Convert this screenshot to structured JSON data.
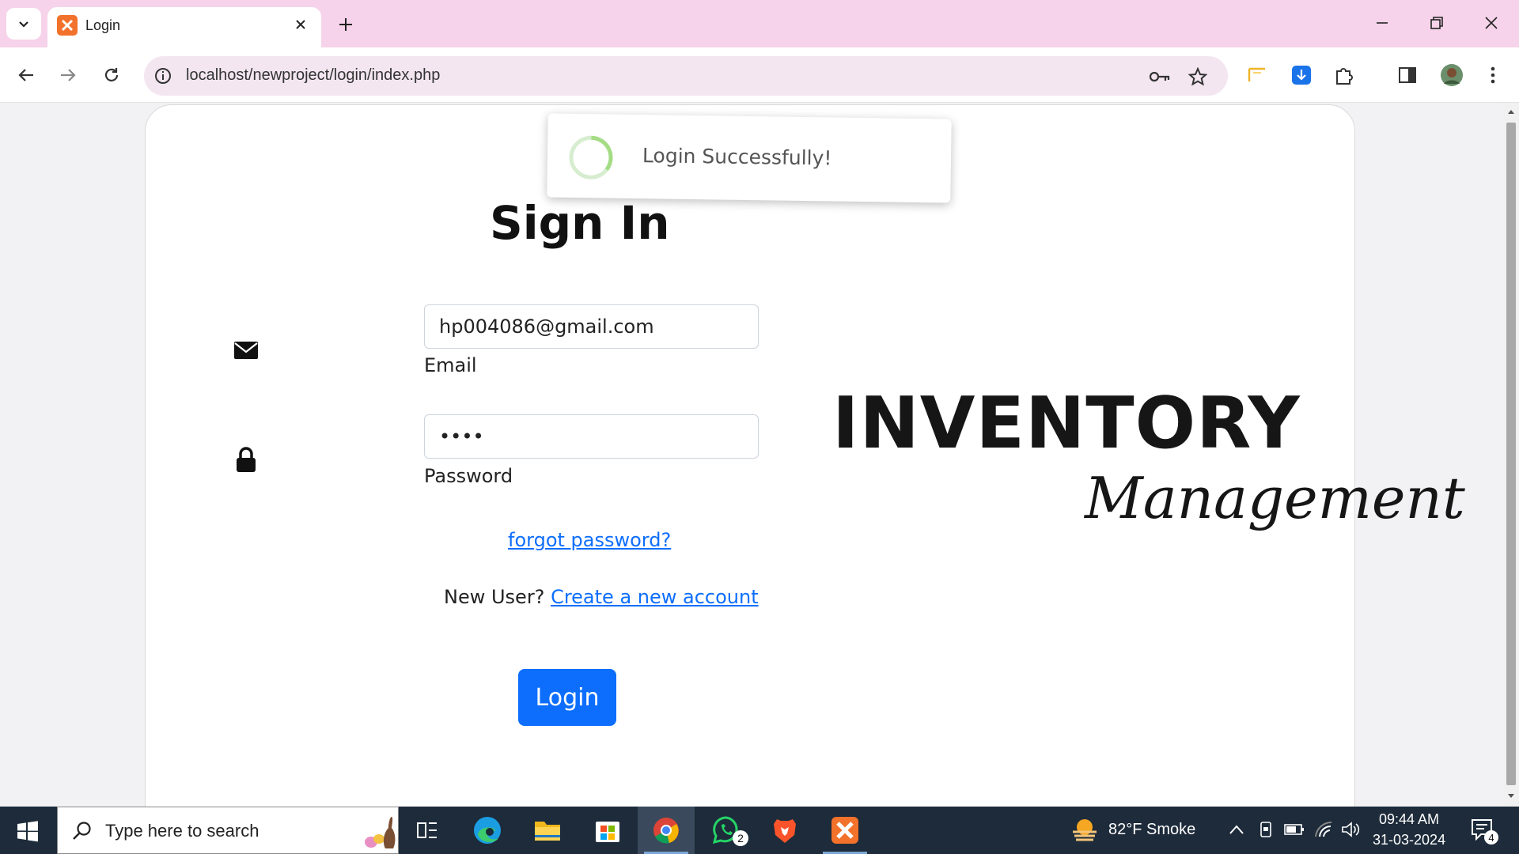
{
  "browser": {
    "tab_title": "Login",
    "url": "localhost/newproject/login/index.php"
  },
  "page": {
    "heading": "Sign In",
    "email_value": "hp004086@gmail.com",
    "email_label": "Email",
    "password_value": "••••",
    "password_label": "Password",
    "forgot_link": "forgot password?",
    "new_user_text": "New User?",
    "create_account_link": "Create a new account",
    "login_button": "Login",
    "logo_line1": "INVENTORY",
    "logo_line2": "Management"
  },
  "toast": {
    "message": "Login Successfully!"
  },
  "taskbar": {
    "search_placeholder": "Type here to search",
    "whatsapp_badge": "2",
    "weather": "82°F  Smoke",
    "time": "09:44 AM",
    "date": "31-03-2024",
    "notification_count": "4"
  },
  "colors": {
    "tabbar": "#f6d3ea",
    "primary": "#0d6efd",
    "taskbar": "#1d2b3a",
    "xampp": "#f2712b"
  }
}
